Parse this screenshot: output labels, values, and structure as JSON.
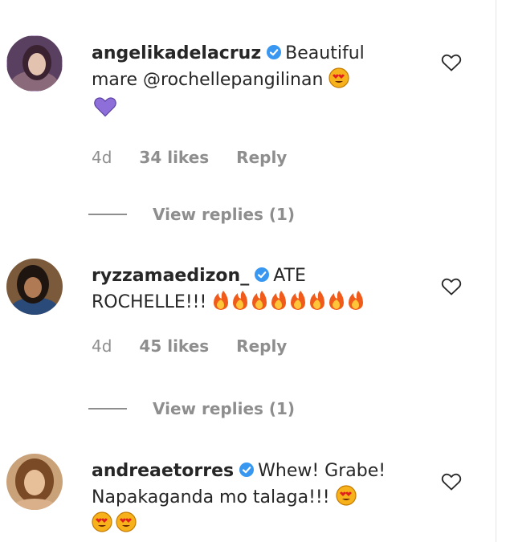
{
  "comments": [
    {
      "username": "angelikadelacruz",
      "text": "Beautiful mare @rochellepangilinan",
      "time": "4d",
      "likes": "34 likes",
      "reply": "Reply",
      "view_replies": "View replies (1)",
      "avatar_icon": "avatar-dark-hair"
    },
    {
      "username": "ryzzamaedizon_",
      "text": "ATE ROCHELLE!!!",
      "time": "4d",
      "likes": "45 likes",
      "reply": "Reply",
      "view_replies": "View replies (1)",
      "avatar_icon": "avatar-dark-hair"
    },
    {
      "username": "andreaetorres",
      "text": "Whew! Grabe! Napakaganda mo talaga!!!",
      "avatar_icon": "avatar-light-hair"
    }
  ],
  "colors": {
    "text": "#262626",
    "muted": "#8e8e8e",
    "verified": "#3897f0",
    "purple_heart": "#8e6fd9"
  }
}
